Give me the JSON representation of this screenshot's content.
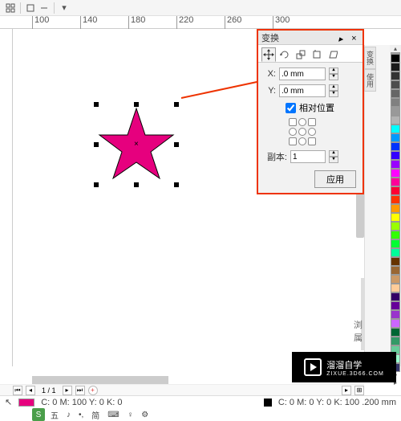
{
  "ruler_h": [
    "100",
    "140",
    "180",
    "220",
    "260",
    "300"
  ],
  "docker": {
    "title": "变换",
    "x_label": "X:",
    "y_label": "Y:",
    "x_val": ".0 mm",
    "y_val": ".0 mm",
    "relative": "相对位置",
    "copies_label": "副本:",
    "copies_val": "1",
    "apply": "应用",
    "side_tabs": [
      "变换",
      "使用"
    ]
  },
  "palette_top": [
    "#000000",
    "#1a1a1a",
    "#333333",
    "#4d4d4d",
    "#666666",
    "#808080",
    "#999999",
    "#b3b3b3"
  ],
  "palette": [
    "#00ffff",
    "#0099ff",
    "#0033ff",
    "#3300ff",
    "#9900ff",
    "#ff00ff",
    "#ff0099",
    "#ff0033",
    "#ff3300",
    "#ff9900",
    "#ffff00",
    "#99ff00",
    "#33ff00",
    "#00ff33",
    "#00ff99",
    "#663300",
    "#996633",
    "#cc9966",
    "#ffcc99",
    "#330066",
    "#660099",
    "#9933cc",
    "#cc66ff",
    "#006633",
    "#339966",
    "#66cc99",
    "#99ffcc",
    "#333366",
    "#666699",
    "#9999cc",
    "#ccccff",
    "#660000",
    "#993333",
    "#cc6666"
  ],
  "nav": {
    "page_of": "1 / 1"
  },
  "status": {
    "fill_info": "C: 0 M: 100 Y: 0 K: 0",
    "outline_info": "C: 0 M: 0 Y: 0 K: 100   .200 mm"
  },
  "ime": {
    "logo": "S",
    "lang": "五",
    "items": [
      "♪",
      "•,",
      "简",
      "⌨",
      "♀",
      "⚙"
    ]
  },
  "watermark": {
    "brand": "溜溜自学",
    "url": "ZIXUE.3D66.COM"
  },
  "extra": {
    "label1": "浏",
    "label2": "属"
  }
}
